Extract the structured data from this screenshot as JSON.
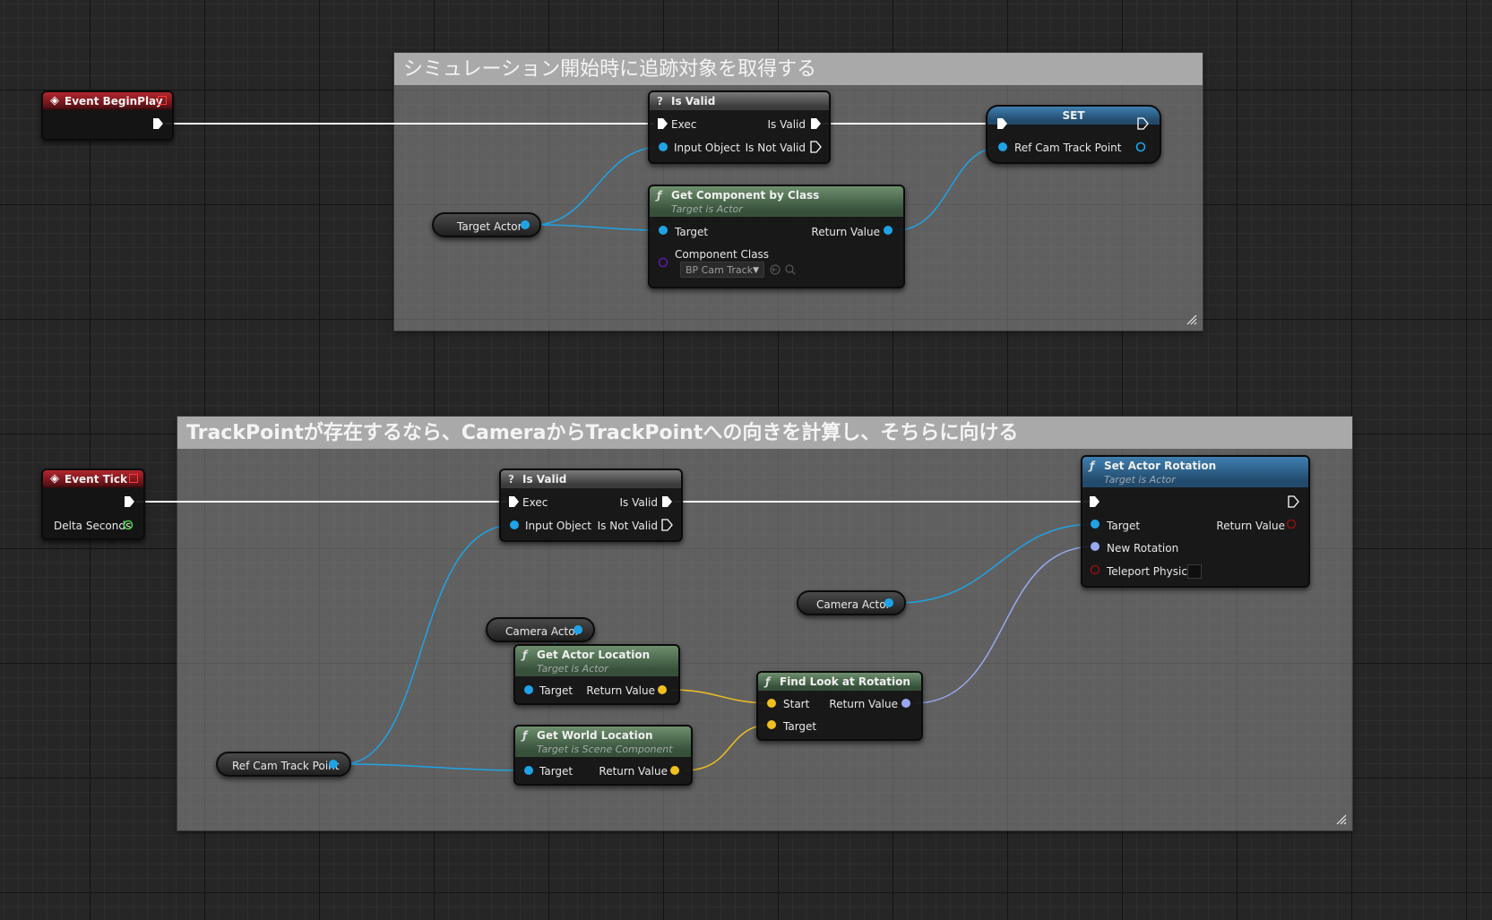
{
  "comments": [
    {
      "title": "シミュレーション開始時に追跡対象を取得する"
    },
    {
      "title": "TrackPointが存在するなら、CameraからTrackPointへの向きを計算し、そちらに向ける"
    }
  ],
  "nodes": {
    "begin_play": {
      "title": "Event BeginPlay"
    },
    "is_valid_1": {
      "title": "Is Valid",
      "exec": "Exec",
      "input_object": "Input Object",
      "is_valid": "Is Valid",
      "is_not_valid": "Is Not Valid"
    },
    "set_node": {
      "title": "SET",
      "var": "Ref Cam Track Point"
    },
    "target_actor": {
      "label": "Target Actor"
    },
    "get_component": {
      "title": "Get Component by Class",
      "subtitle": "Target is Actor",
      "target": "Target",
      "return_value": "Return Value",
      "component_class": "Component Class",
      "component_value": "BP Cam Track"
    },
    "event_tick": {
      "title": "Event Tick",
      "delta": "Delta Seconds"
    },
    "is_valid_2": {
      "title": "Is Valid",
      "exec": "Exec",
      "input_object": "Input Object",
      "is_valid": "Is Valid",
      "is_not_valid": "Is Not Valid"
    },
    "set_actor_rotation": {
      "title": "Set Actor Rotation",
      "subtitle": "Target is Actor",
      "target": "Target",
      "return_value": "Return Value",
      "new_rotation": "New Rotation",
      "teleport": "Teleport Physics"
    },
    "camera_actor_1": {
      "label": "Camera Actor"
    },
    "camera_actor_2": {
      "label": "Camera Actor"
    },
    "get_actor_location": {
      "title": "Get Actor Location",
      "subtitle": "Target is Actor",
      "target": "Target",
      "return_value": "Return Value"
    },
    "find_look_at": {
      "title": "Find Look at Rotation",
      "start": "Start",
      "target": "Target",
      "return_value": "Return Value"
    },
    "get_world_location": {
      "title": "Get World Location",
      "subtitle": "Target is Scene Component",
      "target": "Target",
      "return_value": "Return Value"
    },
    "ref_cam_track_point": {
      "label": "Ref Cam Track Point"
    }
  },
  "colors": {
    "exec": "#ffffff",
    "object": "#1fa3e6",
    "vector": "#f0c020",
    "rotator": "#9aa8f0",
    "bool": "#8a1010",
    "float": "#46d046",
    "class": "#5a1aa0"
  },
  "icons": {
    "event": "event-diamond-icon",
    "function": "function-f-icon",
    "macro": "question-icon"
  }
}
